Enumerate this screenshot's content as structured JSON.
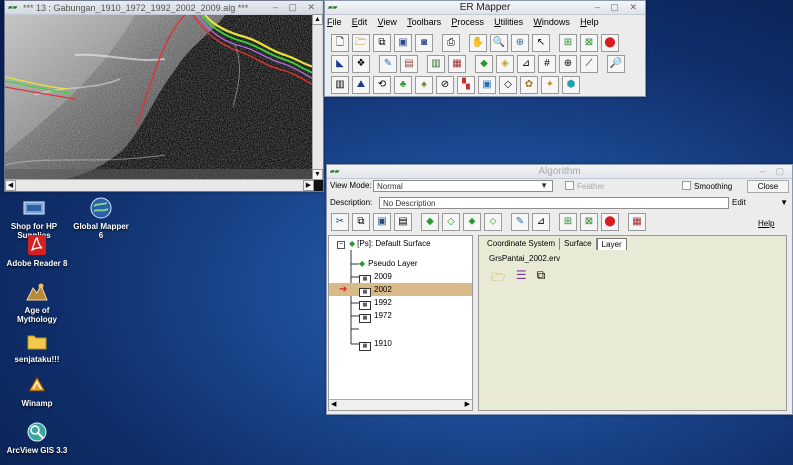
{
  "image_window": {
    "title": "*** 13 : Gabungan_1910_1972_1992_2002_2009.alg ***",
    "controls": [
      "–",
      "▢",
      "✕"
    ]
  },
  "er_mapper": {
    "title": "ER Mapper",
    "controls": [
      "–",
      "▢",
      "✕"
    ],
    "menu": [
      "File",
      "Edit",
      "View",
      "Toolbars",
      "Process",
      "Utilities",
      "Windows",
      "Help"
    ]
  },
  "desktop_icons": [
    {
      "label": "Shop for HP Supplies",
      "icon": "hp-shop-icon"
    },
    {
      "label": "Global Mapper 6",
      "icon": "global-mapper-icon"
    },
    {
      "label": "Adobe Reader 8",
      "icon": "adobe-reader-icon"
    },
    {
      "label": "Age of Mythology",
      "icon": "age-of-mythology-icon"
    },
    {
      "label": "senjataku!!!",
      "icon": "folder-icon"
    },
    {
      "label": "Winamp",
      "icon": "winamp-icon"
    },
    {
      "label": "ArcView GIS 3.3",
      "icon": "arcview-icon"
    }
  ],
  "algorithm": {
    "title": "Algorithm",
    "view_mode_label": "View Mode:",
    "view_mode_value": "Normal",
    "feather_label": "Feather",
    "smoothing_label": "Smoothing",
    "close_label": "Close",
    "edit_label": "Edit",
    "help_label": "Help",
    "description_label": "Description:",
    "description_value": "No Description",
    "tabs": [
      "Coordinate System",
      "Surface",
      "Layer"
    ],
    "active_tab": "Layer",
    "layer_file": "GrsPantai_2002.erv",
    "tree": {
      "root": "[Ps]: Default Surface",
      "nodes": [
        "Pseudo Layer",
        "2009",
        "2002",
        "1992",
        "1972",
        "1910"
      ],
      "selected": "2002"
    }
  },
  "colors": {
    "desktop_bg": "#1c4a92",
    "selection_row": "#d8b98a",
    "pointer_arrow": "#e02020"
  }
}
